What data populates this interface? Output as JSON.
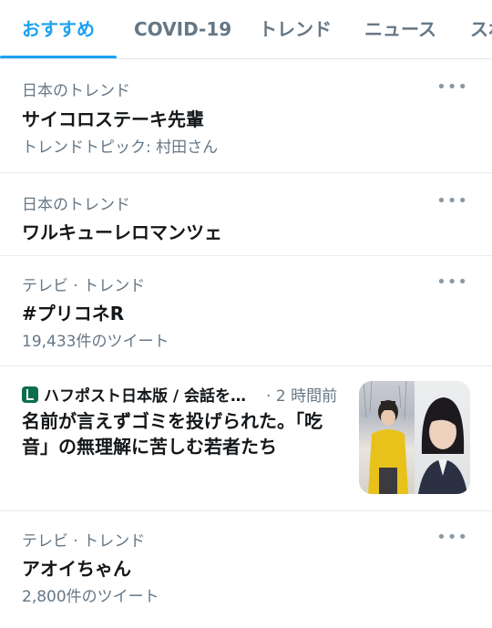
{
  "tabs": [
    {
      "label": "おすすめ",
      "active": true
    },
    {
      "label": "COVID-19",
      "active": false
    },
    {
      "label": "トレンド",
      "active": false
    },
    {
      "label": "ニュース",
      "active": false
    },
    {
      "label": "スポ",
      "active": false
    }
  ],
  "more_icon": "•••",
  "trends": [
    {
      "context": "日本のトレンド",
      "title": "サイコロステーキ先輩",
      "meta": "トレンドトピック: 村田さん"
    },
    {
      "context": "日本のトレンド",
      "title": "ワルキューレロマンツェ",
      "meta": ""
    },
    {
      "context": "テレビ · トレンド",
      "title": "#プリコネR",
      "meta": "19,433件のツイート"
    }
  ],
  "news": {
    "source": "ハフポスト日本版 / 会話を…",
    "time": "· 2 時間前",
    "headline": "名前が言えずゴミを投げられた。「吃音」の無理解に苦しむ若者たち",
    "logo_icon": "huffpost-logo-icon"
  },
  "trend_last": {
    "context": "テレビ · トレンド",
    "title": "アオイちゃん",
    "meta": "2,800件のツイート"
  },
  "colors": {
    "accent": "#1da1f2",
    "secondary_text": "#657786",
    "primary_text": "#14171a"
  }
}
